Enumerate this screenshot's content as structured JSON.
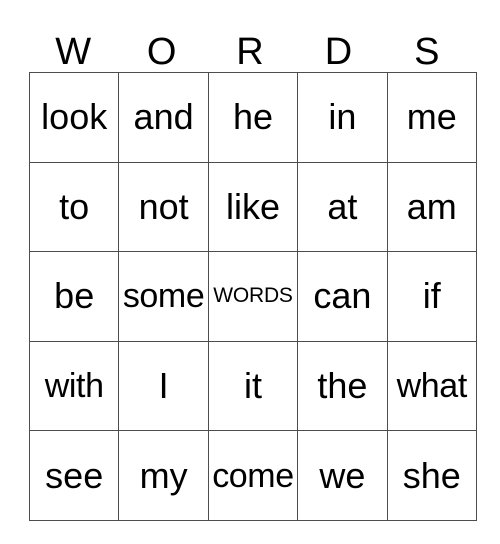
{
  "card": {
    "title_letters": [
      "W",
      "O",
      "R",
      "D",
      "S"
    ],
    "columns": 5,
    "rows": 5,
    "grid": [
      [
        {
          "text": "look",
          "fit": false,
          "free": false
        },
        {
          "text": "and",
          "fit": false,
          "free": false
        },
        {
          "text": "he",
          "fit": false,
          "free": false
        },
        {
          "text": "in",
          "fit": false,
          "free": false
        },
        {
          "text": "me",
          "fit": false,
          "free": false
        }
      ],
      [
        {
          "text": "to",
          "fit": false,
          "free": false
        },
        {
          "text": "not",
          "fit": false,
          "free": false
        },
        {
          "text": "like",
          "fit": false,
          "free": false
        },
        {
          "text": "at",
          "fit": false,
          "free": false
        },
        {
          "text": "am",
          "fit": false,
          "free": false
        }
      ],
      [
        {
          "text": "be",
          "fit": false,
          "free": false
        },
        {
          "text": "some",
          "fit": true,
          "free": false
        },
        {
          "text": "WORDS",
          "fit": false,
          "free": true
        },
        {
          "text": "can",
          "fit": false,
          "free": false
        },
        {
          "text": "if",
          "fit": false,
          "free": false
        }
      ],
      [
        {
          "text": "with",
          "fit": true,
          "free": false
        },
        {
          "text": "I",
          "fit": false,
          "free": false
        },
        {
          "text": "it",
          "fit": false,
          "free": false
        },
        {
          "text": "the",
          "fit": false,
          "free": false
        },
        {
          "text": "what",
          "fit": true,
          "free": false
        }
      ],
      [
        {
          "text": "see",
          "fit": false,
          "free": false
        },
        {
          "text": "my",
          "fit": false,
          "free": false
        },
        {
          "text": "come",
          "fit": true,
          "free": false
        },
        {
          "text": "we",
          "fit": false,
          "free": false
        },
        {
          "text": "she",
          "fit": false,
          "free": false
        }
      ]
    ],
    "colors": {
      "background": "#ffffff",
      "text": "#000000",
      "grid_line": "#4d4d4d"
    }
  }
}
